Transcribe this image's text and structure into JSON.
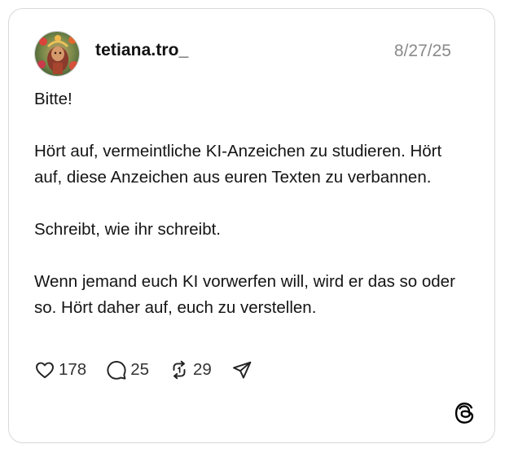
{
  "post": {
    "username": "tetiana.tro_",
    "date": "8/27/25",
    "paragraphs": [
      "Bitte!",
      "Hört auf, vermeintliche KI-Anzeichen zu studieren. Hört auf, diese Anzeichen aus euren Texten zu verbannen.",
      "Schreibt, wie ihr schreibt.",
      "Wenn jemand euch KI vorwerfen will, wird er das so oder so. Hört daher auf, euch zu verstellen."
    ]
  },
  "actions": {
    "likes": "178",
    "replies": "25",
    "reposts": "29"
  },
  "icons": {
    "like": "heart-icon",
    "reply": "comment-bubble-icon",
    "repost": "repost-arrows-icon",
    "share": "send-paper-plane-icon",
    "brand": "threads-logo-icon"
  }
}
